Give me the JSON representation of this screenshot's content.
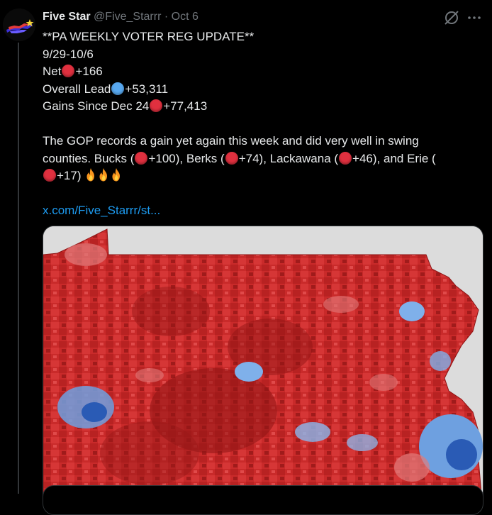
{
  "tweet": {
    "author_name": "Five Star",
    "author_handle": "@Five_Starrr",
    "separator": "·",
    "time": "Oct 6",
    "headline": "**PA WEEKLY VOTER REG UPDATE**",
    "date_range": "9/29-10/6",
    "net_label": "Net",
    "net_value": "+166",
    "lead_label": "Overall Lead",
    "lead_value": "+53,311",
    "gains_label": "Gains Since Dec 24",
    "gains_value": "+77,413",
    "para_line1": "The GOP records a gain yet again this week and did very well in swing",
    "para_line2_a": "counties. Bucks (",
    "para_line2_b": "+100), Berks (",
    "para_line2_c": "+74), Lackawana (",
    "para_line2_d": "+46), and Erie (",
    "para_line3_a": "+17)",
    "link_text": "x.com/Five_Starrr/st..."
  },
  "icons": [
    "grok-icon",
    "more-icon",
    "red-circle-icon",
    "blue-circle-icon",
    "fire-icon"
  ],
  "colors": {
    "background": "#000000",
    "text": "#e7e9ea",
    "muted": "#71767b",
    "link": "#1d9bf0",
    "red": "#e0303f",
    "blue": "#58a8ef"
  }
}
